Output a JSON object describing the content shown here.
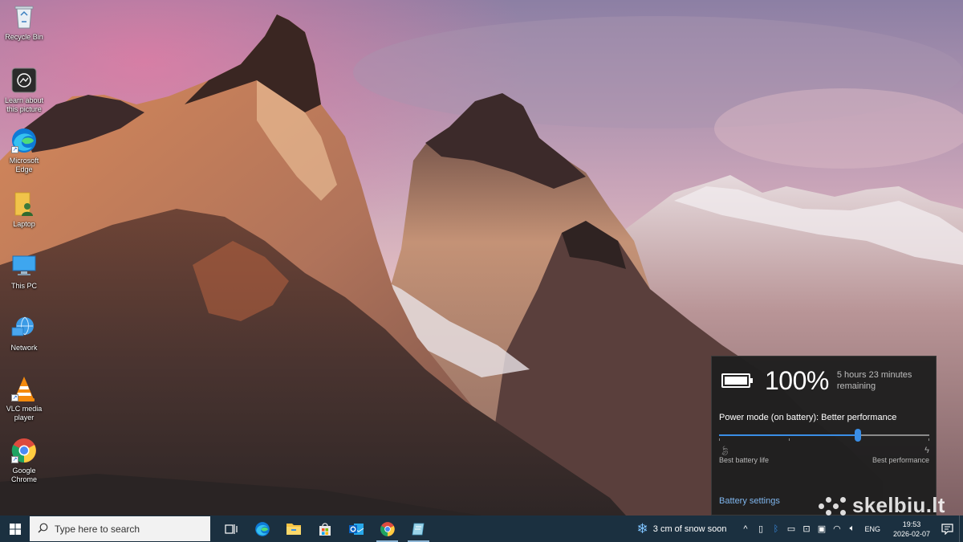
{
  "desktop": {
    "icons": [
      {
        "label": "Recycle Bin",
        "icon": "recycle-bin-icon"
      },
      {
        "label": "Learn about this picture",
        "icon": "learn-picture-icon"
      },
      {
        "label": "Microsoft Edge",
        "icon": "edge-icon"
      },
      {
        "label": "Laptop",
        "icon": "folder-user-icon"
      },
      {
        "label": "This PC",
        "icon": "monitor-icon"
      },
      {
        "label": "Network",
        "icon": "network-icon"
      },
      {
        "label": "VLC media player",
        "icon": "vlc-icon"
      },
      {
        "label": "Google Chrome",
        "icon": "chrome-icon"
      }
    ]
  },
  "battery_flyout": {
    "percent": "100%",
    "remaining": "5 hours 23 minutes remaining",
    "power_mode": "Power mode (on battery): Better performance",
    "slider_level": 0.66,
    "left_label": "Best battery life",
    "right_label": "Best performance",
    "settings_link": "Battery settings"
  },
  "watermark": "skelbiu.lt",
  "taskbar": {
    "search_placeholder": "Type here to search",
    "apps": [
      {
        "name": "task-view-icon",
        "active": false
      },
      {
        "name": "edge-icon",
        "active": false
      },
      {
        "name": "file-explorer-icon",
        "active": false
      },
      {
        "name": "store-icon",
        "active": false
      },
      {
        "name": "outlook-icon",
        "active": false
      },
      {
        "name": "chrome-icon",
        "active": true
      },
      {
        "name": "app-icon",
        "active": true
      }
    ],
    "weather": "3 cm of snow soon",
    "language": "ENG",
    "time": "19:53",
    "date": "2026-02-07"
  },
  "colors": {
    "taskbar": "#1b3040",
    "flyout": "#1f1f1f",
    "accent": "#3a8ee6",
    "link": "#7fb6ee"
  }
}
